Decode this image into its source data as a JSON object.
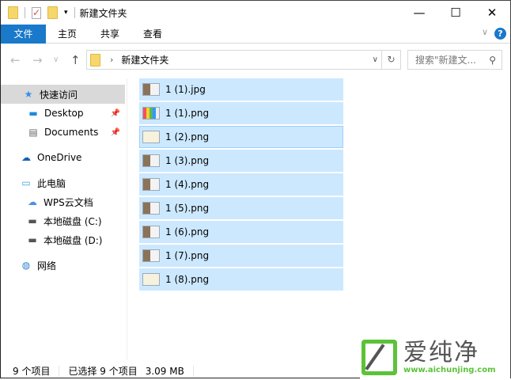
{
  "window": {
    "title": "新建文件夹",
    "minimize": "—",
    "maximize": "☐",
    "close": "✕"
  },
  "ribbon": {
    "tabs": [
      "文件",
      "主页",
      "共享",
      "查看"
    ],
    "help": "?",
    "collapse": "∨"
  },
  "address": {
    "path": "新建文件夹",
    "search_placeholder": "搜索\"新建文...",
    "back": "←",
    "forward": "→",
    "recent": "∨",
    "up": "↑",
    "refresh": "↻",
    "dropdown": "∨",
    "search_icon": "⚲"
  },
  "nav": {
    "items": [
      {
        "label": "快速访问",
        "icon": "star-icon",
        "glyph": "★"
      },
      {
        "label": "Desktop",
        "icon": "desktop-icon",
        "glyph": "▬"
      },
      {
        "label": "Documents",
        "icon": "document-icon",
        "glyph": "▤"
      },
      {
        "label": "OneDrive",
        "icon": "cloud-icon",
        "glyph": "☁"
      },
      {
        "label": "此电脑",
        "icon": "computer-icon",
        "glyph": "▭"
      },
      {
        "label": "WPS云文档",
        "icon": "cloud-outline-icon",
        "glyph": "☁"
      },
      {
        "label": "本地磁盘 (C:)",
        "icon": "drive-icon",
        "glyph": "▬"
      },
      {
        "label": "本地磁盘 (D:)",
        "icon": "drive-icon",
        "glyph": "▬"
      },
      {
        "label": "网络",
        "icon": "network-icon",
        "glyph": "◍"
      }
    ],
    "pin": "📌"
  },
  "files": [
    "1 (1).jpg",
    "1 (1).png",
    "1 (2).png",
    "1 (3).png",
    "1 (4).png",
    "1 (5).png",
    "1 (6).png",
    "1 (7).png",
    "1 (8).png"
  ],
  "status": {
    "count": "9 个项目",
    "selected": "已选择 9 个项目",
    "size": "3.09 MB"
  },
  "watermark": {
    "text": "爱纯净",
    "url": "www.aichunjing.com"
  },
  "colors": {
    "accent": "#1979ca",
    "selection": "#cce8ff",
    "brand_green": "#5cc23a"
  }
}
